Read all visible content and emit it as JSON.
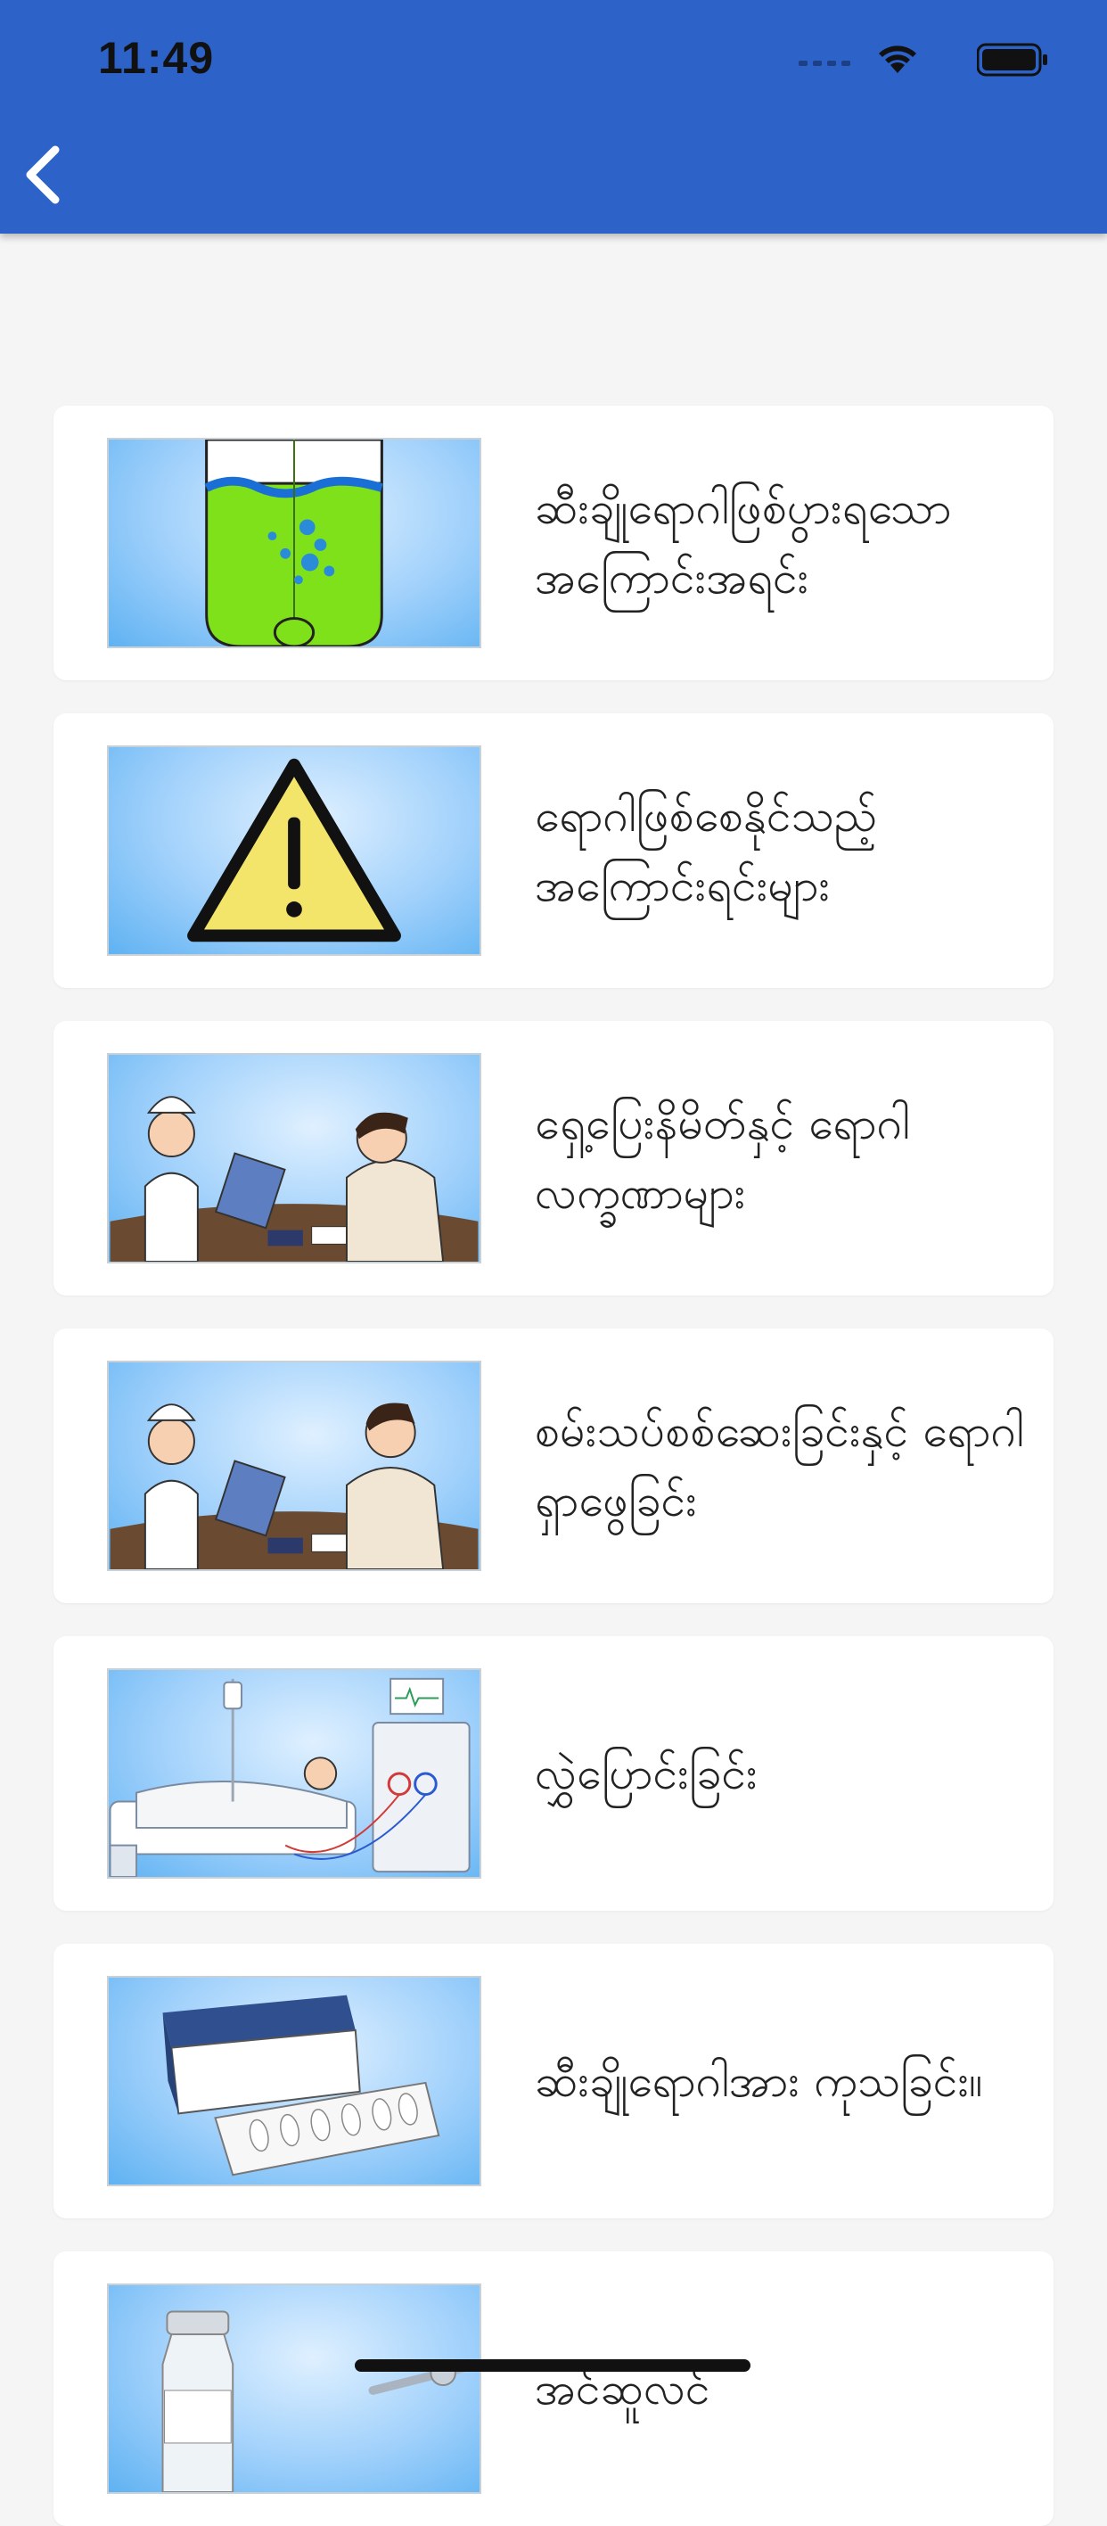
{
  "status_bar": {
    "time": "11:49"
  },
  "nav": {
    "back_icon": "chevron-left-icon"
  },
  "colors": {
    "header": "#2d63c8",
    "background": "#f5f5f5",
    "card": "#ffffff"
  },
  "topics": [
    {
      "title": "ဆီးချိုရောဂါဖြစ်ပွားရသော အကြောင်းအရင်း",
      "image": "bladder-illustration"
    },
    {
      "title": "ရောဂါဖြစ်စေနိုင်သည့် အကြောင်းရင်းများ",
      "image": "warning-sign-illustration"
    },
    {
      "title": "ရှေ့ပြေးနိမိတ်နှင့် ရောဂါ လက္ခဏာများ",
      "image": "nurse-and-tired-patient-illustration"
    },
    {
      "title": "စမ်းသပ်စစ်ဆေးခြင်းနှင့် ရောဂါ ရှာဖွေခြင်း",
      "image": "nurse-and-patient-checkup-illustration"
    },
    {
      "title": "လွှဲပြောင်းခြင်း",
      "image": "dialysis-hospital-bed-illustration"
    },
    {
      "title": "ဆီးချိုရောဂါအား ကုသခြင်း။",
      "image": "medicine-box-illustration"
    },
    {
      "title": "အင်ဆူလင်",
      "image": "insulin-vial-illustration"
    }
  ]
}
